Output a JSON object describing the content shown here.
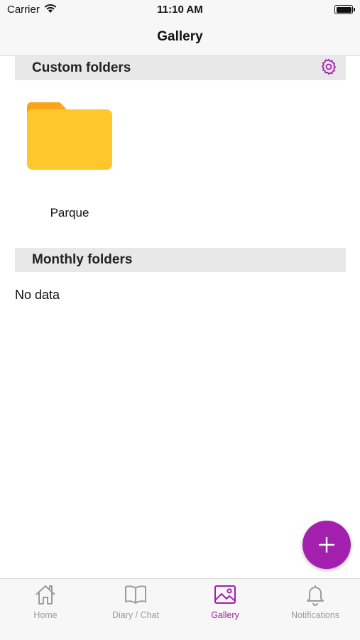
{
  "status_bar": {
    "carrier": "Carrier",
    "time": "11:10 AM"
  },
  "nav": {
    "title": "Gallery"
  },
  "custom_section": {
    "title": "Custom folders",
    "folders": [
      {
        "label": "Parque"
      }
    ]
  },
  "monthly_section": {
    "title": "Monthly folders",
    "empty_text": "No data"
  },
  "tabs": [
    {
      "label": "Home",
      "icon": "home-icon",
      "active": false
    },
    {
      "label": "Diary / Chat",
      "icon": "book-icon",
      "active": false
    },
    {
      "label": "Gallery",
      "icon": "gallery-icon",
      "active": true
    },
    {
      "label": "Notifications",
      "icon": "bell-icon",
      "active": false
    }
  ],
  "colors": {
    "accent": "#a31fae",
    "folder": "#ffc72c",
    "folder_tab": "#f9a51a",
    "inactive_tab": "#9b9b9b",
    "section_bg": "#e8e8e8"
  }
}
